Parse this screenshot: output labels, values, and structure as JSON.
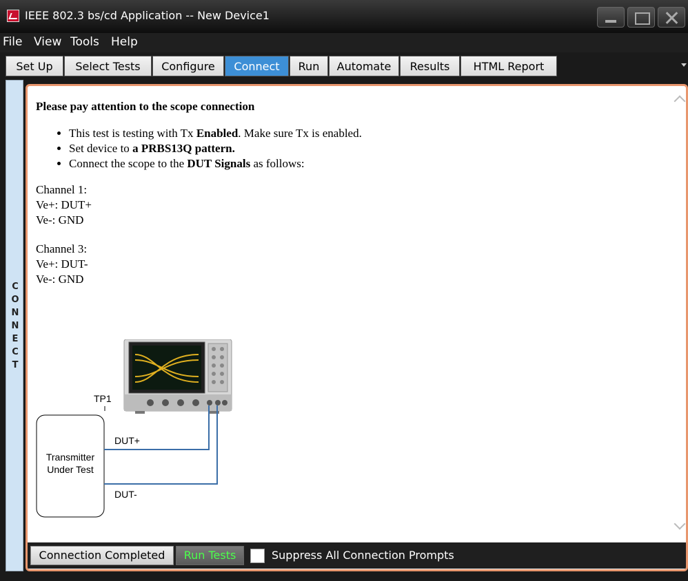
{
  "window": {
    "title": "IEEE 802.3 bs/cd Application -- New Device1"
  },
  "menu": [
    "File",
    "View",
    "Tools",
    "Help"
  ],
  "tabs": [
    {
      "label": "Set Up"
    },
    {
      "label": "Select Tests"
    },
    {
      "label": "Configure"
    },
    {
      "label": "Connect",
      "active": true
    },
    {
      "label": "Run"
    },
    {
      "label": "Automate"
    },
    {
      "label": "Results"
    },
    {
      "label": "HTML Report"
    }
  ],
  "side_label": "CONNECT",
  "content": {
    "heading": "Please pay attention to the scope connection",
    "bullet1": {
      "pre": "This test is testing with Tx ",
      "bold": "Enabled",
      "post": ". Make sure Tx is enabled."
    },
    "bullet2": {
      "pre": "Set device to ",
      "bold": "a PRBS13Q pattern."
    },
    "bullet3": {
      "pre": "Connect the scope to the ",
      "bold": "DUT Signals",
      "post": " as follows:"
    },
    "channel1": {
      "title": "Channel 1:",
      "vplus": "Ve+: DUT+",
      "vminus": "Ve-: GND"
    },
    "channel3": {
      "title": "Channel 3:",
      "vplus": "Ve+: DUT-",
      "vminus": "Ve-: GND"
    }
  },
  "diagram": {
    "tp_label": "TP1",
    "dut_plus": "DUT+",
    "dut_minus": "DUT-",
    "box_line1": "Transmitter",
    "box_line2": "Under Test"
  },
  "bottom": {
    "connection_completed": "Connection Completed",
    "run_tests": "Run Tests",
    "suppress_label": "Suppress All Connection Prompts",
    "suppress_checked": false
  },
  "colors": {
    "active_tab": "#3d8fd6",
    "panel_border": "#e8966d",
    "run_tests_text": "#4cff4c",
    "side_rail": "#cfe3f4",
    "wire": "#3b6ea8"
  }
}
